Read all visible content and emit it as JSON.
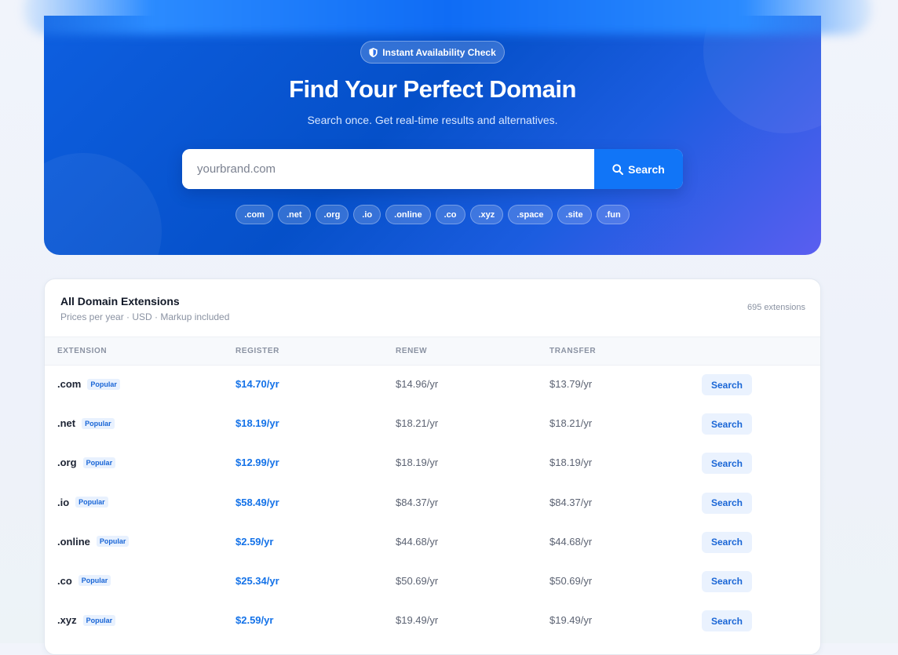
{
  "hero": {
    "badge": "Instant Availability Check",
    "title": "Find Your Perfect Domain",
    "subtitle": "Search once. Get real-time results and alternatives.",
    "search_placeholder": "yourbrand.com",
    "search_button": "Search",
    "chips": [
      ".com",
      ".net",
      ".org",
      ".io",
      ".online",
      ".co",
      ".xyz",
      ".space",
      ".site",
      ".fun"
    ]
  },
  "table": {
    "title": "All Domain Extensions",
    "subtitle": "Prices per year · USD · Markup included",
    "count": "695 extensions",
    "headers": {
      "extension": "EXTENSION",
      "register": "REGISTER",
      "renew": "RENEW",
      "transfer": "TRANSFER"
    },
    "rows": [
      {
        "ext": ".com",
        "badge": "Popular",
        "register": "$14.70/yr",
        "renew": "$14.96/yr",
        "transfer": "$13.79/yr",
        "action": "Search"
      },
      {
        "ext": ".net",
        "badge": "Popular",
        "register": "$18.19/yr",
        "renew": "$18.21/yr",
        "transfer": "$18.21/yr",
        "action": "Search"
      },
      {
        "ext": ".org",
        "badge": "Popular",
        "register": "$12.99/yr",
        "renew": "$18.19/yr",
        "transfer": "$18.19/yr",
        "action": "Search"
      },
      {
        "ext": ".io",
        "badge": "Popular",
        "register": "$58.49/yr",
        "renew": "$84.37/yr",
        "transfer": "$84.37/yr",
        "action": "Search"
      },
      {
        "ext": ".online",
        "badge": "Popular",
        "register": "$2.59/yr",
        "renew": "$44.68/yr",
        "transfer": "$44.68/yr",
        "action": "Search"
      },
      {
        "ext": ".co",
        "badge": "Popular",
        "register": "$25.34/yr",
        "renew": "$50.69/yr",
        "transfer": "$50.69/yr",
        "action": "Search"
      },
      {
        "ext": ".xyz",
        "badge": "Popular",
        "register": "$2.59/yr",
        "renew": "$19.49/yr",
        "transfer": "$19.49/yr",
        "action": "Search"
      }
    ]
  },
  "colors": {
    "accent": "#1175f7",
    "hero_start": "#0e5fe0",
    "hero_end": "#5a5ef0"
  }
}
